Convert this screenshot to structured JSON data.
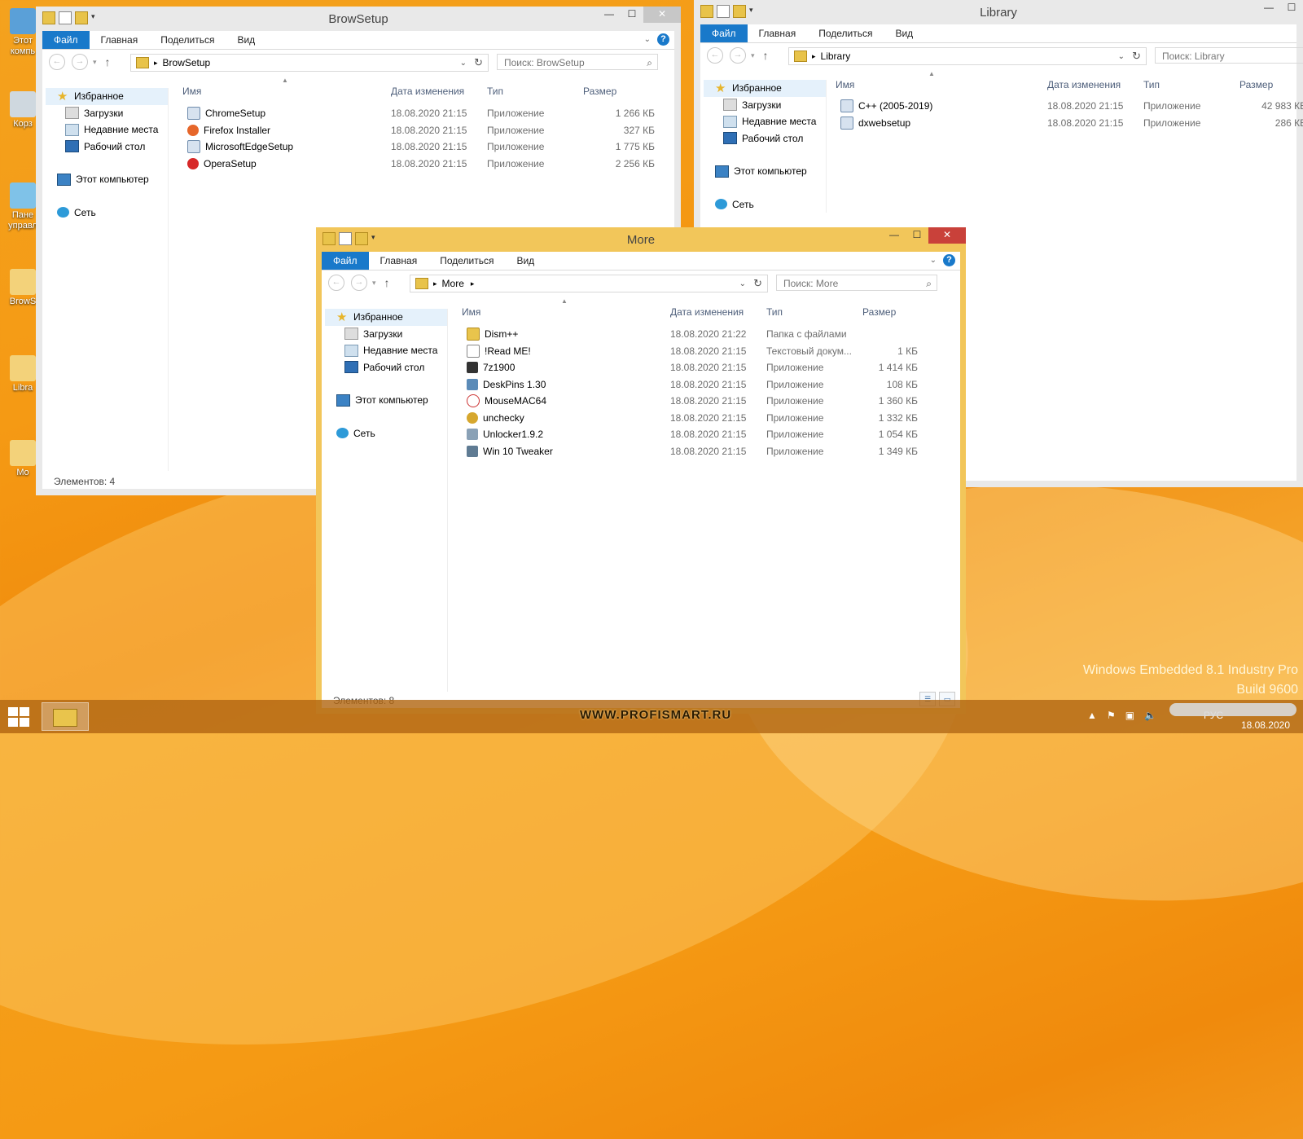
{
  "desktop_icons": [
    {
      "label": "Этот компь"
    },
    {
      "label": "Корз"
    },
    {
      "label": "Пане управл"
    },
    {
      "label": "BrowS"
    },
    {
      "label": "Libra"
    },
    {
      "label": "Mo"
    }
  ],
  "window_browsetup": {
    "title": "BrowSetup",
    "tabs": {
      "file": "Файл",
      "home": "Главная",
      "share": "Поделиться",
      "view": "Вид"
    },
    "path": "BrowSetup",
    "search_placeholder": "Поиск: BrowSetup",
    "nav": {
      "favorites": "Избранное",
      "downloads": "Загрузки",
      "recent": "Недавние места",
      "desktop": "Рабочий стол",
      "computer": "Этот компьютер",
      "network": "Сеть"
    },
    "columns": {
      "name": "Имя",
      "date": "Дата изменения",
      "type": "Тип",
      "size": "Размер"
    },
    "files": [
      {
        "name": "ChromeSetup",
        "date": "18.08.2020 21:15",
        "type": "Приложение",
        "size": "1 266 КБ",
        "icon": "app-icon"
      },
      {
        "name": "Firefox Installer",
        "date": "18.08.2020 21:15",
        "type": "Приложение",
        "size": "327 КБ",
        "icon": "firefox-icon"
      },
      {
        "name": "MicrosoftEdgeSetup",
        "date": "18.08.2020 21:15",
        "type": "Приложение",
        "size": "1 775 КБ",
        "icon": "app-icon"
      },
      {
        "name": "OperaSetup",
        "date": "18.08.2020 21:15",
        "type": "Приложение",
        "size": "2 256 КБ",
        "icon": "opera-icon"
      }
    ],
    "status": "Элементов: 4"
  },
  "window_library": {
    "title": "Library",
    "tabs": {
      "file": "Файл",
      "home": "Главная",
      "share": "Поделиться",
      "view": "Вид"
    },
    "path": "Library",
    "search_placeholder": "Поиск: Library",
    "nav": {
      "favorites": "Избранное",
      "downloads": "Загрузки",
      "recent": "Недавние места",
      "desktop": "Рабочий стол",
      "computer": "Этот компьютер",
      "network": "Сеть"
    },
    "columns": {
      "name": "Имя",
      "date": "Дата изменения",
      "type": "Тип",
      "size": "Размер"
    },
    "files": [
      {
        "name": "C++ (2005-2019)",
        "date": "18.08.2020 21:15",
        "type": "Приложение",
        "size": "42 983 КБ",
        "icon": "installer-icon"
      },
      {
        "name": "dxwebsetup",
        "date": "18.08.2020 21:15",
        "type": "Приложение",
        "size": "286 КБ",
        "icon": "installer-icon"
      }
    ]
  },
  "window_more": {
    "title": "More",
    "tabs": {
      "file": "Файл",
      "home": "Главная",
      "share": "Поделиться",
      "view": "Вид"
    },
    "path": "More",
    "search_placeholder": "Поиск: More",
    "nav": {
      "favorites": "Избранное",
      "downloads": "Загрузки",
      "recent": "Недавние места",
      "desktop": "Рабочий стол",
      "computer": "Этот компьютер",
      "network": "Сеть"
    },
    "columns": {
      "name": "Имя",
      "date": "Дата изменения",
      "type": "Тип",
      "size": "Размер"
    },
    "files": [
      {
        "name": "Dism++",
        "date": "18.08.2020 21:22",
        "type": "Папка с файлами",
        "size": "",
        "icon": "folder-icon"
      },
      {
        "name": "!Read ME!",
        "date": "18.08.2020 21:15",
        "type": "Текстовый докум...",
        "size": "1 КБ",
        "icon": "text-file-icon"
      },
      {
        "name": "7z1900",
        "date": "18.08.2020 21:15",
        "type": "Приложение",
        "size": "1 414 КБ",
        "icon": "7zip-icon"
      },
      {
        "name": "DeskPins 1.30",
        "date": "18.08.2020 21:15",
        "type": "Приложение",
        "size": "108 КБ",
        "icon": "installer-icon"
      },
      {
        "name": "MouseMAC64",
        "date": "18.08.2020 21:15",
        "type": "Приложение",
        "size": "1 360 КБ",
        "icon": "mouse-icon"
      },
      {
        "name": "unchecky",
        "date": "18.08.2020 21:15",
        "type": "Приложение",
        "size": "1 332 КБ",
        "icon": "unchecky-icon"
      },
      {
        "name": "Unlocker1.9.2",
        "date": "18.08.2020 21:15",
        "type": "Приложение",
        "size": "1 054 КБ",
        "icon": "installer-icon"
      },
      {
        "name": "Win 10 Tweaker",
        "date": "18.08.2020 21:15",
        "type": "Приложение",
        "size": "1 349 КБ",
        "icon": "tweaker-icon"
      }
    ],
    "status": "Элементов: 8"
  },
  "watermark": {
    "line1": "Windows Embedded 8.1 Industry Pro",
    "line2": "Build 9600"
  },
  "taskbar": {
    "site": "WWW.PROFISMART.RU",
    "lang": "РУС",
    "date": "18.08.2020"
  },
  "colors": {
    "accent": "#1979ca",
    "active_border": "#f2c65a",
    "close_red": "#c9413a",
    "desktop": "#f59a14"
  }
}
